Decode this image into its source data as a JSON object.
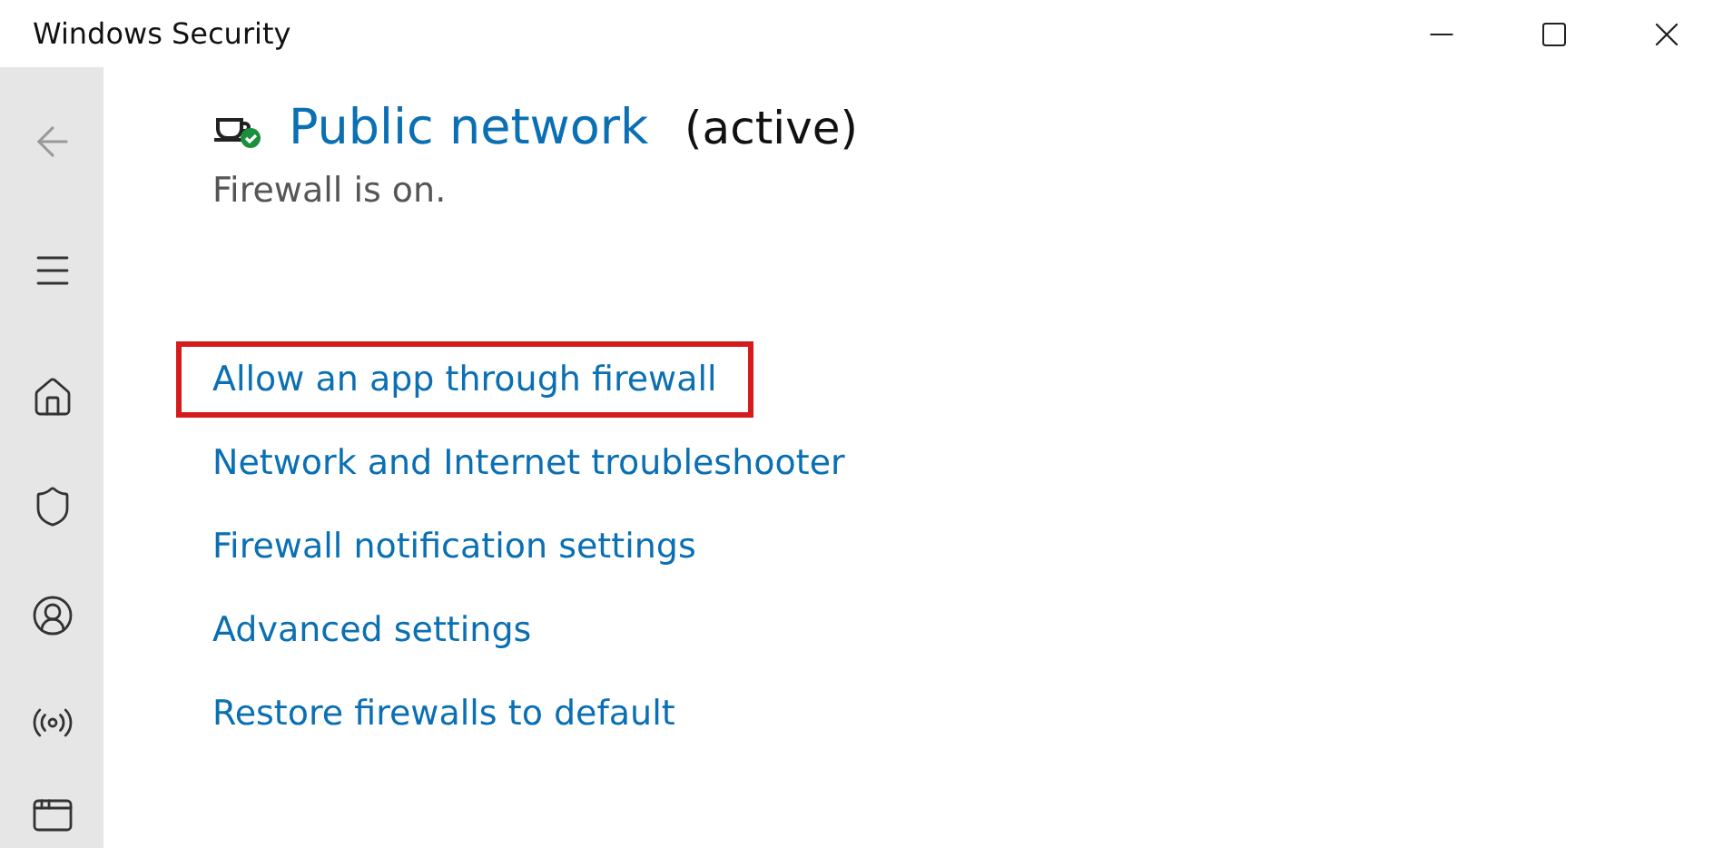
{
  "window": {
    "title": "Windows Security"
  },
  "sidebar": {
    "items": [
      {
        "kind": "back"
      },
      {
        "kind": "menu"
      },
      {
        "kind": "home"
      },
      {
        "kind": "shield"
      },
      {
        "kind": "account"
      },
      {
        "kind": "network"
      },
      {
        "kind": "app"
      }
    ]
  },
  "network": {
    "name": "Public network",
    "status": "(active)",
    "firewall_state": "Firewall is on."
  },
  "links": [
    {
      "label": "Allow an app through firewall",
      "highlighted": true
    },
    {
      "label": "Network and Internet troubleshooter",
      "highlighted": false
    },
    {
      "label": "Firewall notification settings",
      "highlighted": false
    },
    {
      "label": "Advanced settings",
      "highlighted": false
    },
    {
      "label": "Restore firewalls to default",
      "highlighted": false
    }
  ]
}
